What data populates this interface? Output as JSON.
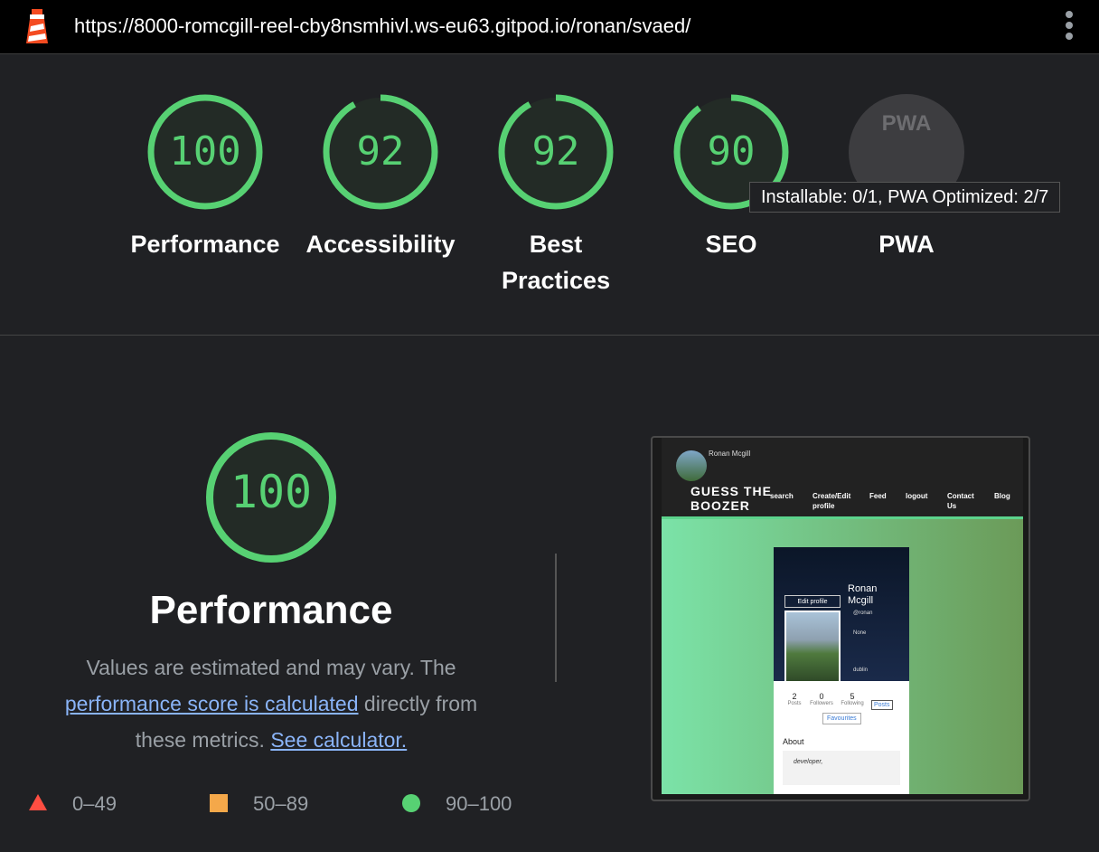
{
  "topbar": {
    "url": "https://8000-romcgill-reel-cby8nsmhivl.ws-eu63.gitpod.io/ronan/svaed/"
  },
  "categories": [
    {
      "label": "Performance",
      "score": "100",
      "fraction": 1.0
    },
    {
      "label": "Accessibility",
      "score": "92",
      "fraction": 0.92
    },
    {
      "label": "Best Practices",
      "score": "92",
      "fraction": 0.92
    },
    {
      "label": "SEO",
      "score": "90",
      "fraction": 0.9
    },
    {
      "label": "PWA",
      "score": "",
      "fraction": 0
    }
  ],
  "pwa_badge_text": "PWA",
  "tooltip": "Installable: 0/1, PWA Optimized: 2/7",
  "performance": {
    "score": "100",
    "fraction": 1.0,
    "title": "Performance",
    "desc_prefix": "Values are estimated and may vary. The",
    "link1": "performance score is calculated",
    "desc_mid": "directly from these metrics.",
    "link2": "See calculator."
  },
  "legend": [
    {
      "range": "0–49",
      "color": "#ff4e42"
    },
    {
      "range": "50–89",
      "color": "#f4a84a"
    },
    {
      "range": "90–100",
      "color": "#57d173"
    }
  ],
  "screenshot": {
    "username": "Ronan Mcgill",
    "brand": "GUESS THE BOOZER",
    "nav": [
      "search",
      "Create/Edit profile",
      "Feed",
      "logout",
      "Contact Us",
      "Blog"
    ],
    "edit_profile": "Edit profile",
    "profile_name": "Ronan Mcgill",
    "handle": "@ronan",
    "none_text": "None",
    "location": "dublin",
    "stats": [
      {
        "value": "2",
        "label": "Posts"
      },
      {
        "value": "0",
        "label": "Followers"
      },
      {
        "value": "5",
        "label": "Following"
      }
    ],
    "posts_button": "Posts",
    "favourites_button": "Favourites",
    "about_title": "About",
    "about_text": "developer,"
  },
  "colors": {
    "pass": "#57d173",
    "background": "#202124"
  }
}
